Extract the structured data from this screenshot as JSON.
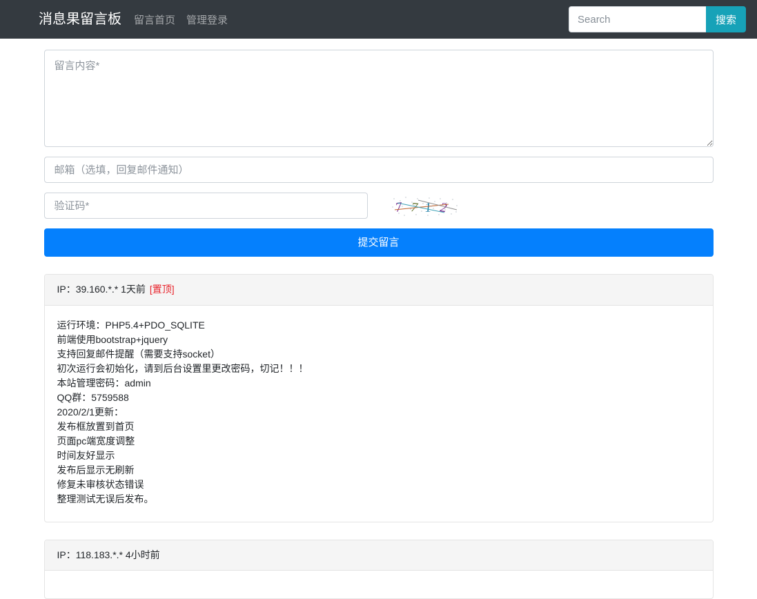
{
  "navbar": {
    "brand": "消息果留言板",
    "links": [
      {
        "label": "留言首页",
        "name": "nav-link-home"
      },
      {
        "label": "管理登录",
        "name": "nav-link-admin-login"
      }
    ],
    "search": {
      "placeholder": "Search",
      "value": "",
      "button_label": "搜索"
    },
    "colors": {
      "background": "#343a40",
      "search_button": "#17a2b8"
    }
  },
  "form": {
    "content": {
      "placeholder": "留言内容*",
      "value": ""
    },
    "email": {
      "placeholder": "邮箱（选填，回复邮件通知）",
      "value": ""
    },
    "captcha": {
      "placeholder": "验证码*",
      "value": "",
      "image_text": "7712",
      "image_name": "captcha-image"
    },
    "submit_label": "提交留言",
    "submit_color": "#0580fd"
  },
  "messages": [
    {
      "ip_label": "IP：",
      "ip": "39.160.*.*",
      "time": "1天前",
      "badge": "[置顶]",
      "badge_color": "#e8242c",
      "body_lines": [
        "运行环境：PHP5.4+PDO_SQLITE",
        "前端使用bootstrap+jquery",
        "支持回复邮件提醒（需要支持socket）",
        "初次运行会初始化，请到后台设置里更改密码，切记！！！",
        "本站管理密码：admin",
        "QQ群：5759588",
        "2020/2/1更新：",
        "发布框放置到首页",
        "页面pc端宽度调整",
        "时间友好显示",
        "发布后显示无刷新",
        "修复未审核状态错误",
        "整理测试无误后发布。"
      ]
    },
    {
      "ip_label": "IP：",
      "ip": "118.183.*.*",
      "time": "4小时前",
      "badge": "",
      "badge_color": "#e8242c",
      "body_lines": []
    }
  ]
}
